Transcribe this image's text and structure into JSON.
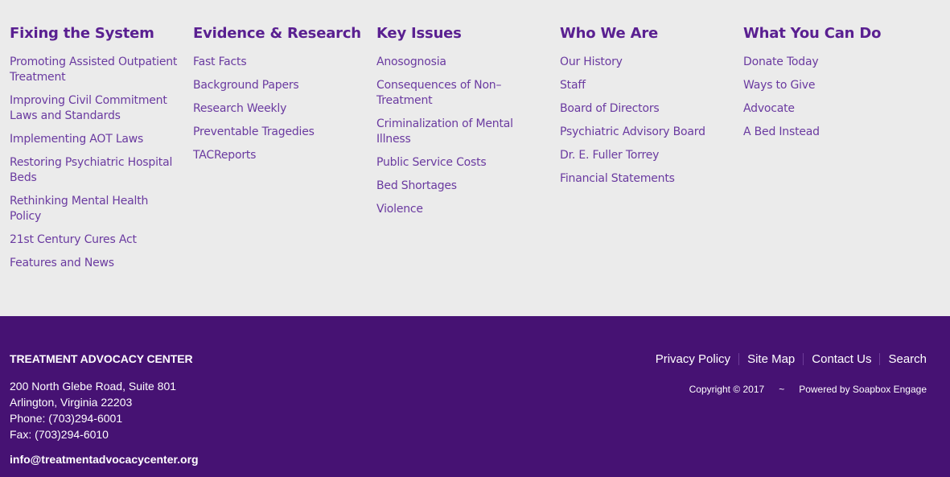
{
  "columns": [
    {
      "heading": "Fixing the System",
      "links": [
        "Promoting Assisted Outpatient Treatment",
        "Improving Civil Commitment Laws and Standards",
        "Implementing AOT Laws",
        "Restoring Psychiatric Hospital Beds",
        "Rethinking Mental Health Policy",
        "21st Century Cures Act",
        "Features and News"
      ]
    },
    {
      "heading": "Evidence & Research",
      "links": [
        "Fast Facts",
        "Background Papers",
        "Research Weekly",
        "Preventable Tragedies",
        "TACReports"
      ]
    },
    {
      "heading": "Key Issues",
      "links": [
        "Anosognosia",
        "Consequences of Non–Treatment",
        "Criminalization of Mental Illness",
        "Public Service Costs",
        "Bed Shortages",
        "Violence"
      ]
    },
    {
      "heading": "Who We Are",
      "links": [
        "Our History",
        "Staff",
        "Board of Directors",
        "Psychiatric Advisory Board",
        "Dr. E. Fuller Torrey",
        "Financial Statements"
      ]
    },
    {
      "heading": "What You Can Do",
      "links": [
        "Donate Today",
        "Ways to Give",
        "Advocate",
        "A Bed Instead"
      ]
    }
  ],
  "footer": {
    "org_name": "TREATMENT ADVOCACY CENTER",
    "address_line1": "200 North Glebe Road, Suite 801",
    "address_line2": "Arlington, Virginia 22203",
    "phone": "Phone: (703)294-6001",
    "fax": "Fax: (703)294-6010",
    "email": "info@treatmentadvocacycenter.org",
    "links": [
      "Privacy Policy",
      "Site Map",
      "Contact Us",
      "Search"
    ],
    "copyright": "Copyright © 2017",
    "separator": "~",
    "powered_by": "Powered by Soapbox Engage"
  },
  "colors": {
    "top_background": "#ebebeb",
    "heading": "#5a2091",
    "link": "#6a3aa0",
    "footer_background": "#461273",
    "footer_text": "#ffffff"
  }
}
